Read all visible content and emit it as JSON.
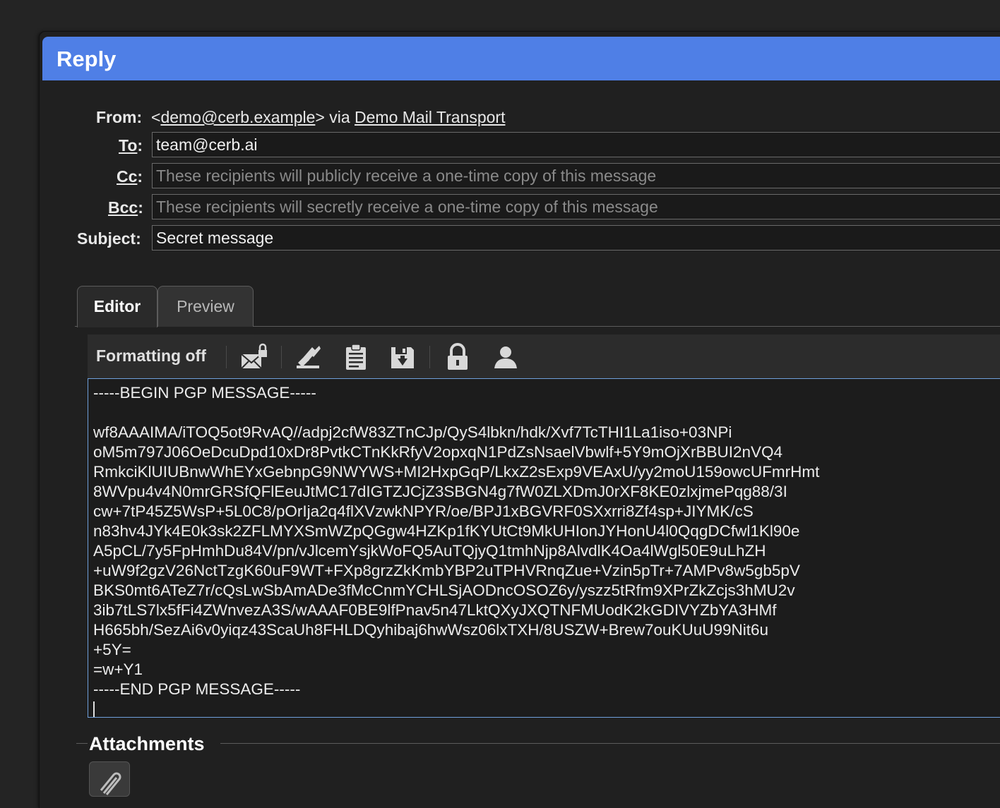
{
  "dialog": {
    "title": "Reply"
  },
  "from": {
    "label": "From:",
    "prefix": "<",
    "address": "demo@cerb.example",
    "suffix": "> via",
    "transport": "Demo Mail Transport"
  },
  "to": {
    "label": "To",
    "colon": ":",
    "value": "team@cerb.ai"
  },
  "cc": {
    "label": "Cc",
    "colon": ":",
    "value": "",
    "placeholder": "These recipients will publicly receive a one-time copy of this message"
  },
  "bcc": {
    "label": "Bcc",
    "colon": ":",
    "value": "",
    "placeholder": "These recipients will secretly receive a one-time copy of this message"
  },
  "subject": {
    "label": "Subject:",
    "value": "Secret message"
  },
  "tabs": [
    {
      "label": "Editor",
      "active": true
    },
    {
      "label": "Preview",
      "active": false
    }
  ],
  "toolbar": {
    "formatting_label": "Formatting off",
    "icons": [
      "encrypted-mail-icon",
      "signature-icon",
      "clipboard-icon",
      "save-draft-icon",
      "lock-icon",
      "user-icon"
    ]
  },
  "editor": {
    "body": "-----BEGIN PGP MESSAGE-----\n\nwf8AAAIMA/iTOQ5ot9RvAQ//adpj2cfW83ZTnCJp/QyS4lbkn/hdk/Xvf7TcTHI1La1iso+03NPi\noM5m797J06OeDcuDpd10xDr8PvtkCTnKkRfyV2opxqN1PdZsNsaelVbwlf+5Y9mOjXrBBUI2nVQ4\nRmkciKlUIUBnwWhEYxGebnpG9NWYWS+MI2HxpGqP/LkxZ2sExp9VEAxU/yy2moU159owcUFmrHmt\n8WVpu4v4N0mrGRSfQFlEeuJtMC17dIGTZJCjZ3SBGN4g7fW0ZLXDmJ0rXF8KE0zlxjmePqg88/3I\ncw+7tP45Z5WsP+5L0C8/pOrIja2q4flXVzwkNPYR/oe/BPJ1xBGVRF0SXxrri8Zf4sp+JIYMK/cS\nn83hv4JYk4E0k3sk2ZFLMYXSmWZpQGgw4HZKp1fKYUtCt9MkUHIonJYHonU4l0QqgDCfwl1Kl90e\nA5pCL/7y5FpHmhDu84V/pn/vJlcemYsjkWoFQ5AuTQjyQ1tmhNjp8AlvdlK4Oa4lWgl50E9uLhZH\n+uW9f2gzV26NctTzgK60uF9WT+FXp8grzZkKmbYBP2uTPHVRnqZue+Vzin5pTr+7AMPv8w5gb5pV\nBKS0mt6ATeZ7r/cQsLwSbAmADe3fMcCnmYCHLSjAODncOSOZ6y/yszz5tRfm9XPrZkZcjs3hMU2v\n3ib7tLS7lx5fFi4ZWnvezA3S/wAAAF0BE9lfPnav5n47LktQXyJXQTNFMUodK2kGDIVYZbYA3HMf\nH665bh/SezAi6v0yiqz43ScaUh8FHLDQyhibaj6hwWsz06lxTXH/8USZW+Brew7ouKUuU99Nit6u\n+5Y=\n=w+Y1\n-----END PGP MESSAGE-----\n"
  },
  "attachments": {
    "title": "Attachments",
    "icon": "paperclip-icon"
  }
}
